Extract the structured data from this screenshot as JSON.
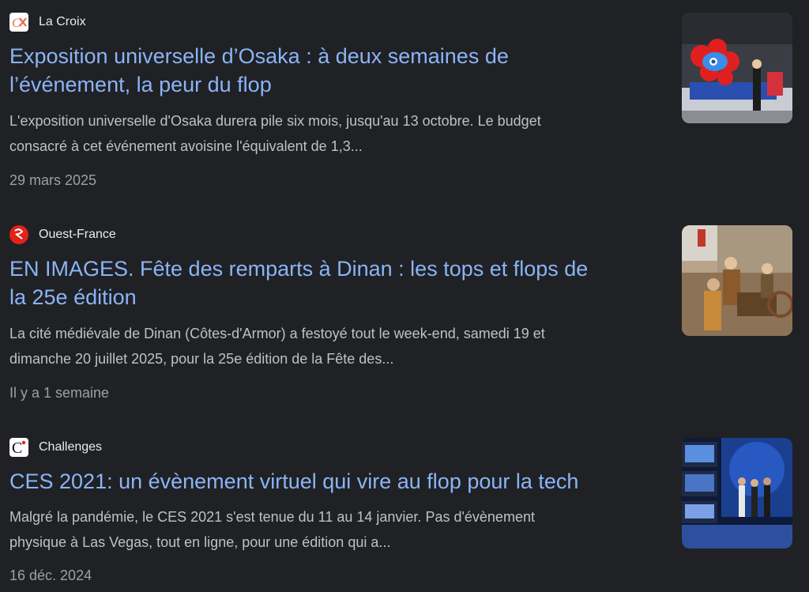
{
  "results": [
    {
      "source": "La Croix",
      "favicon": "la-croix-icon",
      "title_line1": "Exposition universelle d’Osaka : à deux semaines de",
      "title_line2": "l’événement, la peur du flop",
      "snippet_line1": "L'exposition universelle d'Osaka durera pile six mois, jusqu'au 13 octobre. Le budget",
      "snippet_line2": "consacré à cet événement avoisine l'équivalent de 1,3...",
      "date": "29 mars 2025",
      "thumbnail": "osaka-mascot-photo"
    },
    {
      "source": "Ouest-France",
      "favicon": "ouest-france-icon",
      "title_line1": "EN IMAGES. Fête des remparts à Dinan : les tops et flops de",
      "title_line2": "la 25e édition",
      "snippet_line1": "La cité médiévale de Dinan (Côtes-d'Armor) a festoyé tout le week-end, samedi 19 et",
      "snippet_line2": "dimanche 20 juillet 2025, pour la 25e édition de la Fête des...",
      "date": "Il y a 1 semaine",
      "thumbnail": "dinan-festival-photo"
    },
    {
      "source": "Challenges",
      "favicon": "challenges-icon",
      "title_line1": "CES 2021: un évènement virtuel qui vire au flop pour la tech",
      "snippet_line1": "Malgré la pandémie, le CES 2021 s'est tenue du 11 au 14 janvier. Pas d'évènement",
      "snippet_line2": "physique à Las Vegas, tout en ligne, pour une édition qui a...",
      "date": "16 déc. 2024",
      "thumbnail": "ces-studio-photo"
    }
  ],
  "colors": {
    "background": "#202124",
    "title": "#8ab4f8",
    "source": "#e8eaed",
    "snippet": "#bdc1c6",
    "date": "#9aa0a6"
  }
}
